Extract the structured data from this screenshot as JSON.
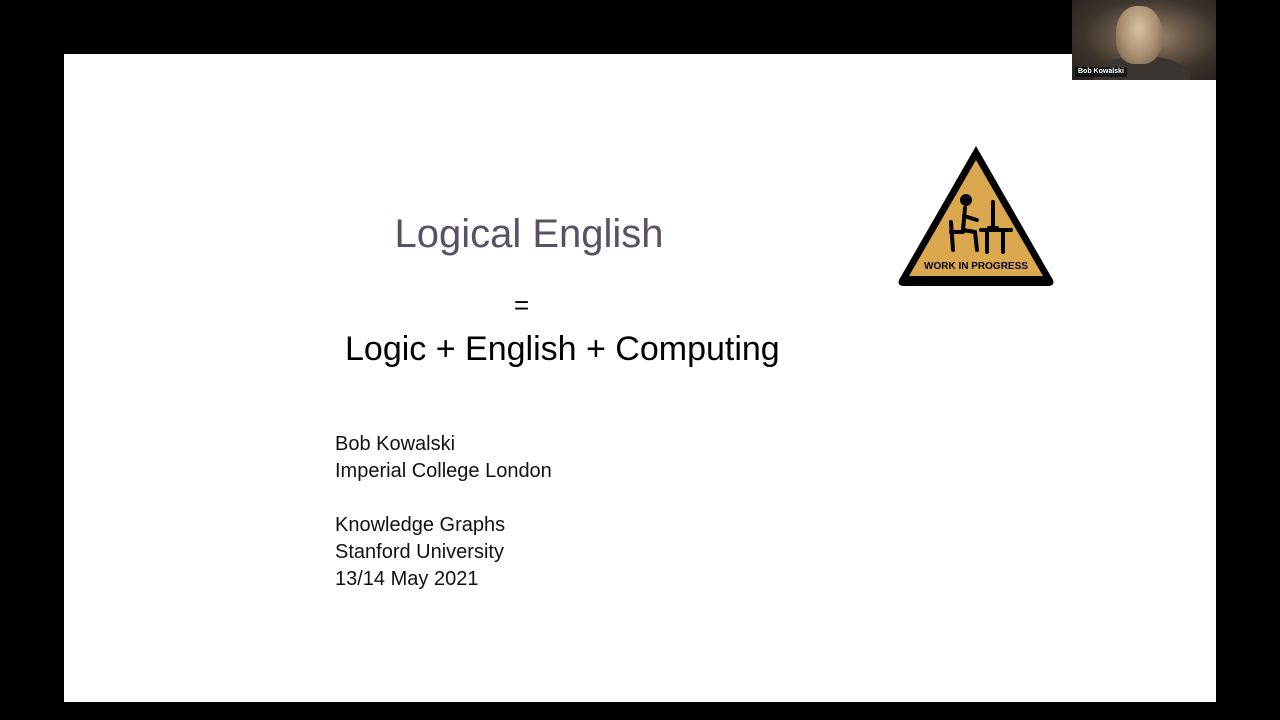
{
  "slide": {
    "title": "Logical English",
    "equals": "=",
    "formula": "Logic + English + Computing",
    "author_lines": [
      "Bob Kowalski",
      "Imperial College London",
      "",
      "Knowledge Graphs",
      "Stanford University",
      "13/14 May 2021"
    ],
    "sign": {
      "icon": "work-in-progress-sign",
      "text": "WORK IN PROGRESS",
      "fill_color": "#dca84f",
      "border_color": "#000000"
    }
  },
  "webcam": {
    "participant_name": "Bob Kowalski"
  },
  "colors": {
    "title": "#5a5066",
    "background": "#000000",
    "slide": "#ffffff"
  }
}
